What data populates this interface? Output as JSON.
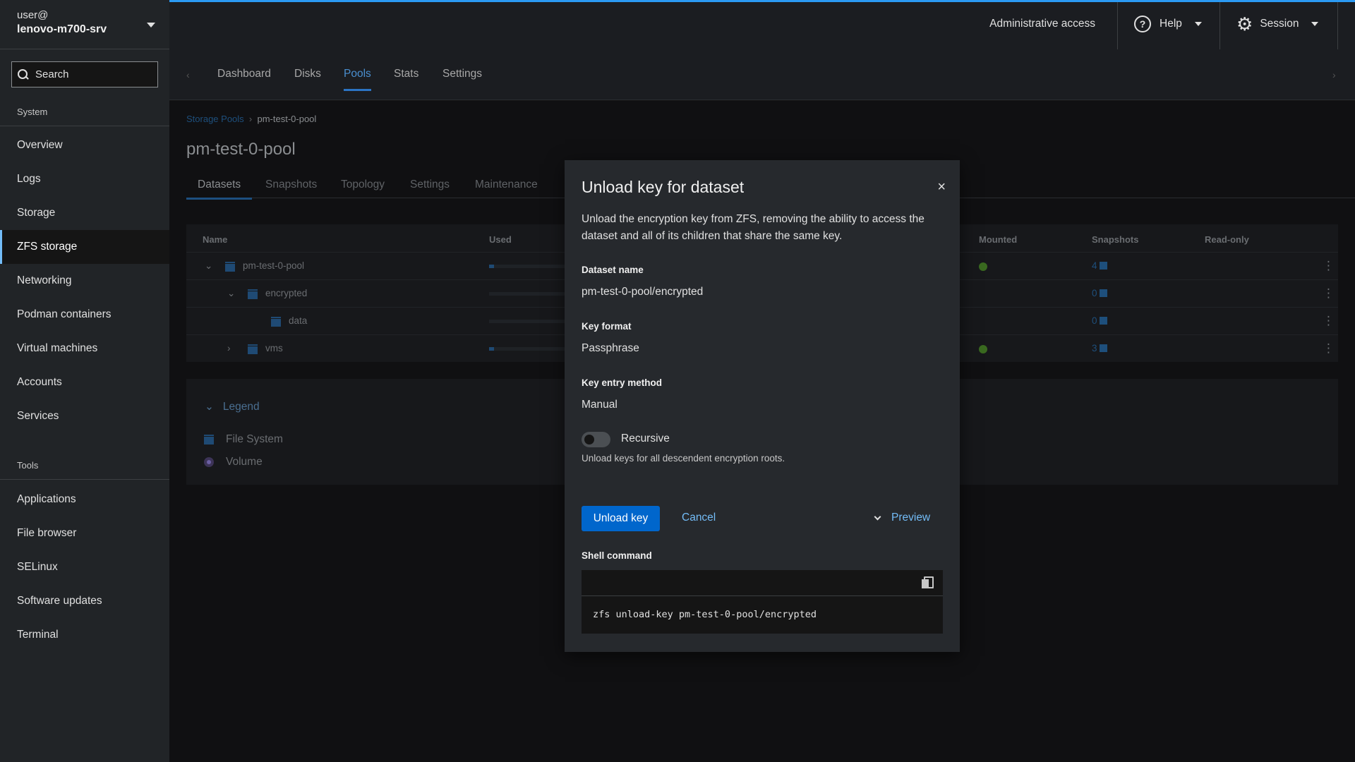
{
  "host": {
    "user": "user@",
    "name": "lenovo-m700-srv"
  },
  "search": {
    "label": "Search"
  },
  "sidebar": {
    "system_label": "System",
    "system_items": [
      "Overview",
      "Logs",
      "Storage",
      "ZFS storage",
      "Networking",
      "Podman containers",
      "Virtual machines",
      "Accounts",
      "Services"
    ],
    "tools_label": "Tools",
    "tools_items": [
      "Applications",
      "File browser",
      "SELinux",
      "Software updates",
      "Terminal"
    ],
    "active": "ZFS storage"
  },
  "header": {
    "admin": "Administrative access",
    "help": "Help",
    "session": "Session"
  },
  "main_tabs": [
    "Dashboard",
    "Disks",
    "Pools",
    "Stats",
    "Settings"
  ],
  "breadcrumb": {
    "parent": "Storage Pools",
    "current": "pm-test-0-pool"
  },
  "page_title": "pm-test-0-pool",
  "pool_tabs": [
    "Datasets",
    "Snapshots",
    "Topology",
    "Settings",
    "Maintenance"
  ],
  "table": {
    "headers": {
      "name": "Name",
      "used": "Used",
      "mounted": "Mounted",
      "snapshots": "Snapshots",
      "readonly": "Read-only"
    },
    "rows": [
      {
        "name": "pm-test-0-pool",
        "snapshots": "4"
      },
      {
        "name": "encrypted",
        "snapshots": "0"
      },
      {
        "name": "data",
        "snapshots": "0"
      },
      {
        "name": "vms",
        "snapshots": "3"
      }
    ]
  },
  "legend": {
    "title": "Legend",
    "file_system": "File System",
    "volume": "Volume"
  },
  "modal": {
    "title": "Unload key for dataset",
    "close": "×",
    "description": "Unload the encryption key from ZFS, removing the ability to access the dataset and all of its children that share the same key.",
    "dataset_name_label": "Dataset name",
    "dataset_name": "pm-test-0-pool/encrypted",
    "key_format_label": "Key format",
    "key_format": "Passphrase",
    "key_entry_label": "Key entry method",
    "key_entry": "Manual",
    "recursive_label": "Recursive",
    "recursive_help": "Unload keys for all descendent encryption roots.",
    "unload_button": "Unload key",
    "cancel_button": "Cancel",
    "preview": "Preview",
    "shell_label": "Shell command",
    "shell_command": "zfs unload-key pm-test-0-pool/encrypted"
  },
  "colors": {
    "accent": "#2b9af3",
    "primary_button": "#0066cc",
    "link": "#73bcf7"
  }
}
